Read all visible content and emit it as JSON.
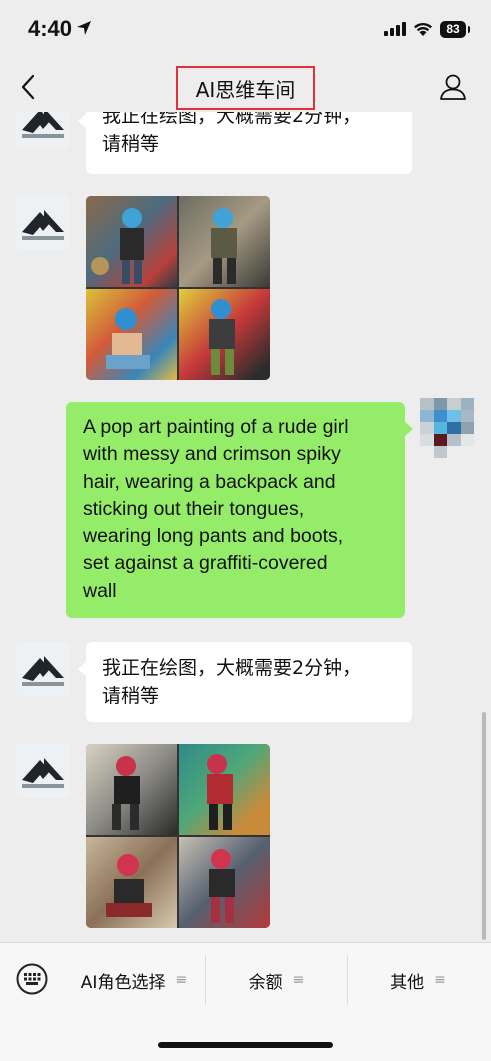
{
  "status_bar": {
    "time": "4:40",
    "battery": "83",
    "icons": [
      "location-arrow-icon",
      "signal-icon",
      "wifi-icon",
      "battery-icon"
    ]
  },
  "header": {
    "title": "AI思维车间",
    "highlight_color": "#e0323c",
    "left_icon": "back-chevron-icon",
    "right_icon": "profile-icon"
  },
  "messages": [
    {
      "from": "bot",
      "type": "text",
      "text": "我正在绘图，大概需要2分钟，请稍等",
      "lines": [
        "我正在绘图，大概需要2分钟，",
        "请稍等"
      ]
    },
    {
      "from": "bot",
      "type": "image",
      "description": "2x2 grid"
    },
    {
      "from": "user",
      "type": "text",
      "lines": [
        "A pop art painting of a rude girl",
        "with messy and crimson spiky",
        "hair, wearing a backpack and",
        "sticking out their tongues,",
        "wearing long pants and boots,",
        "set against a graffiti-covered",
        "wall"
      ]
    },
    {
      "from": "bot",
      "type": "text",
      "lines": [
        "我正在绘图，大概需要2分钟，",
        "请稍等"
      ]
    },
    {
      "from": "bot",
      "type": "image",
      "description": "2x2 grid"
    }
  ],
  "bottom_menu": {
    "keyboard_icon": "keyboard-icon",
    "items": [
      {
        "label": "AI角色选择",
        "icon": "≡"
      },
      {
        "label": "余额",
        "icon": "≡"
      },
      {
        "label": "其他",
        "icon": "≡"
      }
    ]
  },
  "colors": {
    "background": "#ededed",
    "bubble_user": "#95ec69",
    "bubble_bot": "#ffffff"
  }
}
